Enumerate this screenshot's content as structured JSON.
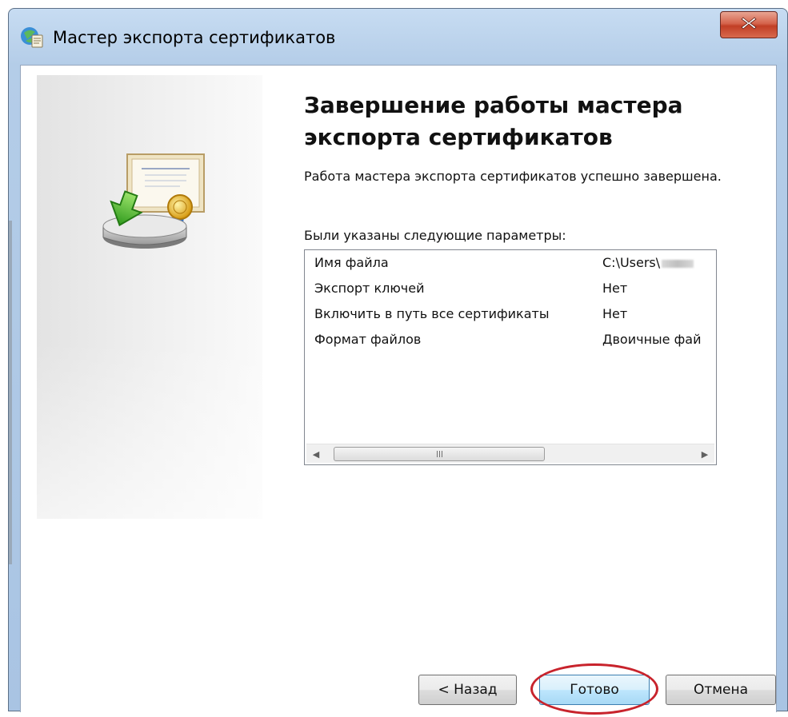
{
  "window": {
    "title": "Мастер экспорта сертификатов",
    "title_icon": "certificate-wizard-icon",
    "close_icon": "close-icon"
  },
  "wizard": {
    "heading": "Завершение работы мастера экспорта сертификатов",
    "description": "Работа мастера экспорта сертификатов успешно завершена.",
    "params_label": "Были указаны следующие параметры:",
    "params": [
      {
        "name": "Имя файла",
        "value": "C:\\Users\\"
      },
      {
        "name": "Экспорт ключей",
        "value": "Нет"
      },
      {
        "name": "Включить в путь все сертификаты",
        "value": "Нет"
      },
      {
        "name": "Формат файлов",
        "value": "Двоичные фай"
      }
    ]
  },
  "buttons": {
    "back": "< Назад",
    "finish": "Готово",
    "cancel": "Отмена"
  },
  "colors": {
    "highlight": "#c8232c",
    "close_button": "#c13e25",
    "default_button_border": "#3c7fb1"
  }
}
